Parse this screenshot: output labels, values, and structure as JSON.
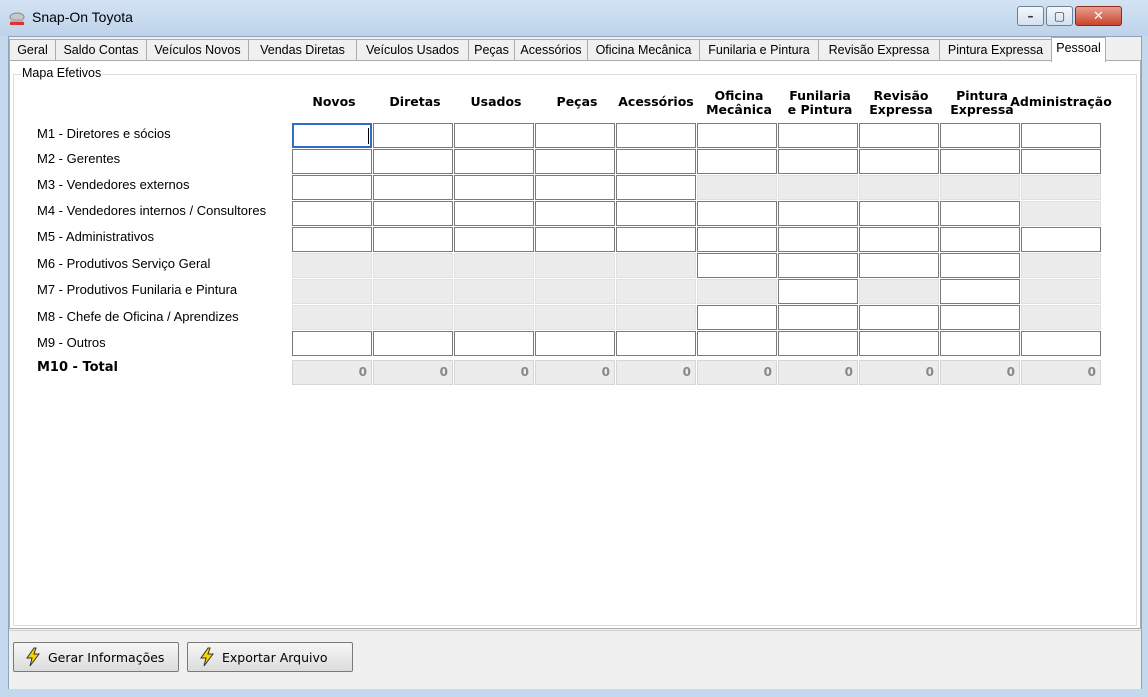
{
  "window": {
    "title": "Snap-On Toyota",
    "controls": {
      "minimize": "–",
      "maximize": "▢",
      "close": "✕"
    }
  },
  "tabs": [
    {
      "label": "Geral"
    },
    {
      "label": "Saldo Contas"
    },
    {
      "label": "Veículos Novos"
    },
    {
      "label": "Vendas Diretas"
    },
    {
      "label": "Veículos Usados"
    },
    {
      "label": "Peças"
    },
    {
      "label": "Acessórios"
    },
    {
      "label": "Oficina Mecânica"
    },
    {
      "label": "Funilaria e Pintura"
    },
    {
      "label": "Revisão Expressa"
    },
    {
      "label": "Pintura Expressa"
    },
    {
      "label": "Pessoal",
      "active": true
    }
  ],
  "group": {
    "label": "Mapa Efetivos"
  },
  "columns": [
    {
      "line1": "Novos",
      "line2": ""
    },
    {
      "line1": "Diretas",
      "line2": ""
    },
    {
      "line1": "Usados",
      "line2": ""
    },
    {
      "line1": "Peças",
      "line2": ""
    },
    {
      "line1": "Acessórios",
      "line2": ""
    },
    {
      "line1": "Oficina",
      "line2": "Mecânica"
    },
    {
      "line1": "Funilaria",
      "line2": "e Pintura"
    },
    {
      "line1": "Revisão",
      "line2": "Expressa"
    },
    {
      "line1": "Pintura",
      "line2": "Expressa"
    },
    {
      "line1": "Administração",
      "line2": ""
    }
  ],
  "rows": [
    {
      "label": "M1 - Diretores e sócios",
      "enabled": [
        1,
        1,
        1,
        1,
        1,
        1,
        1,
        1,
        1,
        1
      ]
    },
    {
      "label": "M2 - Gerentes",
      "enabled": [
        1,
        1,
        1,
        1,
        1,
        1,
        1,
        1,
        1,
        1
      ]
    },
    {
      "label": "M3 - Vendedores externos",
      "enabled": [
        1,
        1,
        1,
        1,
        1,
        0,
        0,
        0,
        0,
        0
      ]
    },
    {
      "label": "M4 - Vendedores internos / Consultores",
      "enabled": [
        1,
        1,
        1,
        1,
        1,
        1,
        1,
        1,
        1,
        0
      ]
    },
    {
      "label": "M5 - Administrativos",
      "enabled": [
        1,
        1,
        1,
        1,
        1,
        1,
        1,
        1,
        1,
        1
      ]
    },
    {
      "label": "M6 - Produtivos Serviço Geral",
      "enabled": [
        0,
        0,
        0,
        0,
        0,
        1,
        1,
        1,
        1,
        0
      ]
    },
    {
      "label": "M7 - Produtivos Funilaria e Pintura",
      "enabled": [
        0,
        0,
        0,
        0,
        0,
        0,
        1,
        0,
        1,
        0
      ]
    },
    {
      "label": "M8 - Chefe de Oficina / Aprendizes",
      "enabled": [
        0,
        0,
        0,
        0,
        0,
        1,
        1,
        1,
        1,
        0
      ]
    },
    {
      "label": "M9 - Outros",
      "enabled": [
        1,
        1,
        1,
        1,
        1,
        1,
        1,
        1,
        1,
        1
      ]
    }
  ],
  "total": {
    "label": "M10 - Total",
    "values": [
      "0",
      "0",
      "0",
      "0",
      "0",
      "0",
      "0",
      "0",
      "0",
      "0"
    ]
  },
  "buttons": {
    "generate": "Gerar Informações",
    "export": "Exportar Arquivo"
  }
}
